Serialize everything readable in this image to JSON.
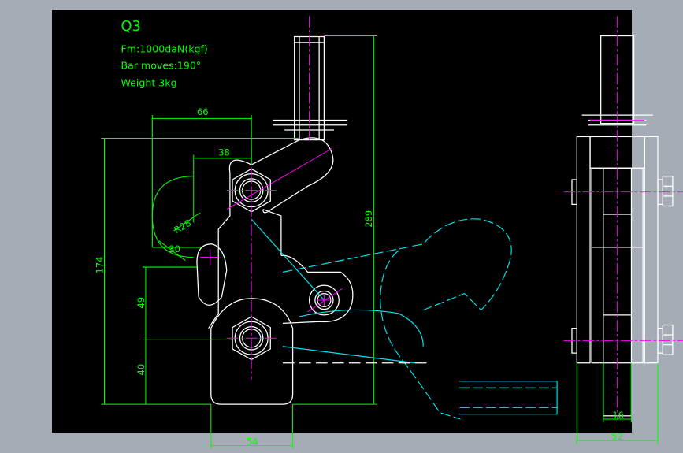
{
  "drawing": {
    "title": "Q3",
    "specs": [
      "Fm:1000daN(kgf)",
      "Bar moves:190°",
      "Weight 3kg"
    ]
  },
  "dimensions": {
    "d66": "66",
    "d38": "38",
    "dR28": "R28",
    "d30": "30",
    "d174": "174",
    "d49": "49",
    "d40": "40",
    "d289": "289",
    "d54": "54",
    "d16": "16",
    "d52": "52"
  },
  "colors": {
    "background_frame": "#a6acb6",
    "drawing_bg": "#000000",
    "dimension": "#00ff00",
    "outline": "#ffffff",
    "alt_position": "#00e5ee",
    "centerline": "#ff00ff"
  }
}
